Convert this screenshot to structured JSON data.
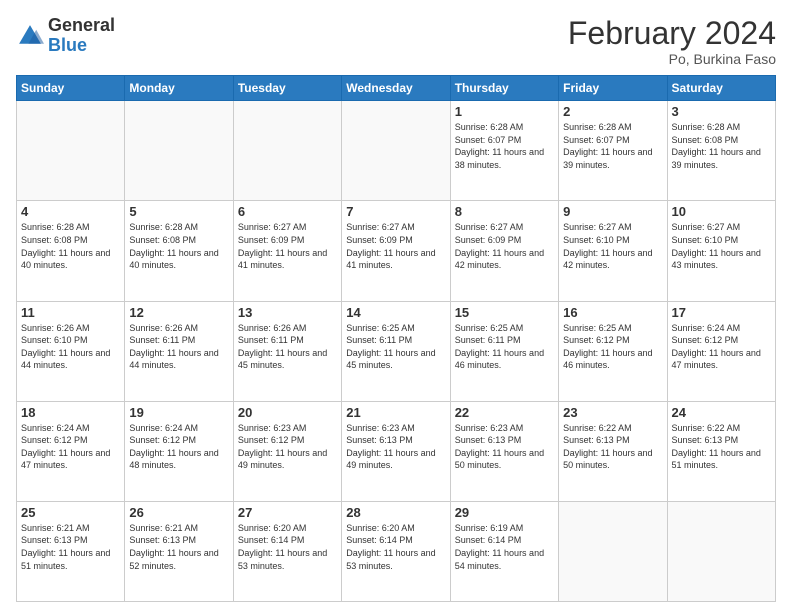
{
  "header": {
    "logo_general": "General",
    "logo_blue": "Blue",
    "month_title": "February 2024",
    "location": "Po, Burkina Faso"
  },
  "weekdays": [
    "Sunday",
    "Monday",
    "Tuesday",
    "Wednesday",
    "Thursday",
    "Friday",
    "Saturday"
  ],
  "weeks": [
    [
      {
        "day": "",
        "sunrise": "",
        "sunset": "",
        "daylight": ""
      },
      {
        "day": "",
        "sunrise": "",
        "sunset": "",
        "daylight": ""
      },
      {
        "day": "",
        "sunrise": "",
        "sunset": "",
        "daylight": ""
      },
      {
        "day": "",
        "sunrise": "",
        "sunset": "",
        "daylight": ""
      },
      {
        "day": "1",
        "sunrise": "6:28 AM",
        "sunset": "6:07 PM",
        "daylight": "11 hours and 38 minutes."
      },
      {
        "day": "2",
        "sunrise": "6:28 AM",
        "sunset": "6:07 PM",
        "daylight": "11 hours and 39 minutes."
      },
      {
        "day": "3",
        "sunrise": "6:28 AM",
        "sunset": "6:08 PM",
        "daylight": "11 hours and 39 minutes."
      }
    ],
    [
      {
        "day": "4",
        "sunrise": "6:28 AM",
        "sunset": "6:08 PM",
        "daylight": "11 hours and 40 minutes."
      },
      {
        "day": "5",
        "sunrise": "6:28 AM",
        "sunset": "6:08 PM",
        "daylight": "11 hours and 40 minutes."
      },
      {
        "day": "6",
        "sunrise": "6:27 AM",
        "sunset": "6:09 PM",
        "daylight": "11 hours and 41 minutes."
      },
      {
        "day": "7",
        "sunrise": "6:27 AM",
        "sunset": "6:09 PM",
        "daylight": "11 hours and 41 minutes."
      },
      {
        "day": "8",
        "sunrise": "6:27 AM",
        "sunset": "6:09 PM",
        "daylight": "11 hours and 42 minutes."
      },
      {
        "day": "9",
        "sunrise": "6:27 AM",
        "sunset": "6:10 PM",
        "daylight": "11 hours and 42 minutes."
      },
      {
        "day": "10",
        "sunrise": "6:27 AM",
        "sunset": "6:10 PM",
        "daylight": "11 hours and 43 minutes."
      }
    ],
    [
      {
        "day": "11",
        "sunrise": "6:26 AM",
        "sunset": "6:10 PM",
        "daylight": "11 hours and 44 minutes."
      },
      {
        "day": "12",
        "sunrise": "6:26 AM",
        "sunset": "6:11 PM",
        "daylight": "11 hours and 44 minutes."
      },
      {
        "day": "13",
        "sunrise": "6:26 AM",
        "sunset": "6:11 PM",
        "daylight": "11 hours and 45 minutes."
      },
      {
        "day": "14",
        "sunrise": "6:25 AM",
        "sunset": "6:11 PM",
        "daylight": "11 hours and 45 minutes."
      },
      {
        "day": "15",
        "sunrise": "6:25 AM",
        "sunset": "6:11 PM",
        "daylight": "11 hours and 46 minutes."
      },
      {
        "day": "16",
        "sunrise": "6:25 AM",
        "sunset": "6:12 PM",
        "daylight": "11 hours and 46 minutes."
      },
      {
        "day": "17",
        "sunrise": "6:24 AM",
        "sunset": "6:12 PM",
        "daylight": "11 hours and 47 minutes."
      }
    ],
    [
      {
        "day": "18",
        "sunrise": "6:24 AM",
        "sunset": "6:12 PM",
        "daylight": "11 hours and 47 minutes."
      },
      {
        "day": "19",
        "sunrise": "6:24 AM",
        "sunset": "6:12 PM",
        "daylight": "11 hours and 48 minutes."
      },
      {
        "day": "20",
        "sunrise": "6:23 AM",
        "sunset": "6:12 PM",
        "daylight": "11 hours and 49 minutes."
      },
      {
        "day": "21",
        "sunrise": "6:23 AM",
        "sunset": "6:13 PM",
        "daylight": "11 hours and 49 minutes."
      },
      {
        "day": "22",
        "sunrise": "6:23 AM",
        "sunset": "6:13 PM",
        "daylight": "11 hours and 50 minutes."
      },
      {
        "day": "23",
        "sunrise": "6:22 AM",
        "sunset": "6:13 PM",
        "daylight": "11 hours and 50 minutes."
      },
      {
        "day": "24",
        "sunrise": "6:22 AM",
        "sunset": "6:13 PM",
        "daylight": "11 hours and 51 minutes."
      }
    ],
    [
      {
        "day": "25",
        "sunrise": "6:21 AM",
        "sunset": "6:13 PM",
        "daylight": "11 hours and 51 minutes."
      },
      {
        "day": "26",
        "sunrise": "6:21 AM",
        "sunset": "6:13 PM",
        "daylight": "11 hours and 52 minutes."
      },
      {
        "day": "27",
        "sunrise": "6:20 AM",
        "sunset": "6:14 PM",
        "daylight": "11 hours and 53 minutes."
      },
      {
        "day": "28",
        "sunrise": "6:20 AM",
        "sunset": "6:14 PM",
        "daylight": "11 hours and 53 minutes."
      },
      {
        "day": "29",
        "sunrise": "6:19 AM",
        "sunset": "6:14 PM",
        "daylight": "11 hours and 54 minutes."
      },
      {
        "day": "",
        "sunrise": "",
        "sunset": "",
        "daylight": ""
      },
      {
        "day": "",
        "sunrise": "",
        "sunset": "",
        "daylight": ""
      }
    ]
  ]
}
